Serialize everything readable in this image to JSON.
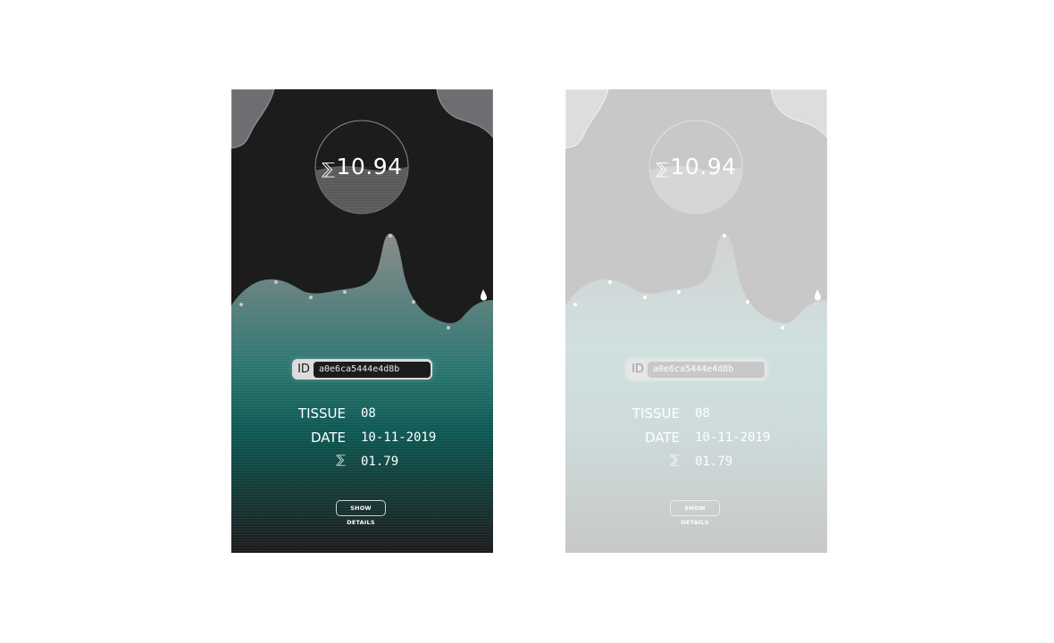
{
  "cards": [
    {
      "theme": "dark",
      "balance": {
        "currency_symbol": "⅀",
        "amount": "10.94"
      },
      "id": {
        "label": "ID",
        "value": "a0e6ca5444e4d8b"
      },
      "info": [
        {
          "label": "TISSUE",
          "value": "08"
        },
        {
          "label": "DATE",
          "value": "10-11-2019"
        },
        {
          "label": "⅀",
          "value": "01.79"
        }
      ],
      "button_label": "SHOW DETAILS",
      "colors": {
        "background": "#1c1c1c",
        "wave": "#0f5a55",
        "corner_blobs": "#6c6e72"
      }
    },
    {
      "theme": "light",
      "balance": {
        "currency_symbol": "⅀",
        "amount": "10.94"
      },
      "id": {
        "label": "ID",
        "value": "a0e6ca5444e4d8b"
      },
      "info": [
        {
          "label": "TISSUE",
          "value": "08"
        },
        {
          "label": "DATE",
          "value": "10-11-2019"
        },
        {
          "label": "⅀",
          "value": "01.79"
        }
      ],
      "button_label": "SHOW DETAILS",
      "colors": {
        "background": "#c8c8c8",
        "wave": "#cfe0df",
        "corner_blobs": "#dcdddc"
      }
    }
  ]
}
